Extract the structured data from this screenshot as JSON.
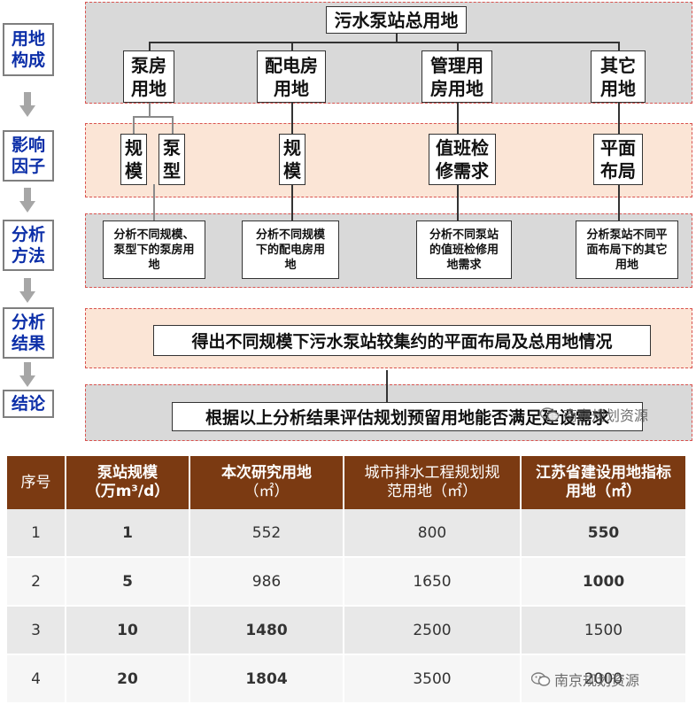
{
  "stages": [
    {
      "label": "用地构成"
    },
    {
      "label": "影响因子"
    },
    {
      "label": "分析方法"
    },
    {
      "label": "分析结果"
    },
    {
      "label": "结论"
    }
  ],
  "root": "污水泵站总用地",
  "components": [
    "泵房用地",
    "配电房用地",
    "管理用房用地",
    "其它用地"
  ],
  "factors": [
    "规模",
    "泵型",
    "规模",
    "值班检修需求",
    "平面布局"
  ],
  "methods": [
    "分析不同规模、泵型下的泵房用地",
    "分析不同规模下的配电房用地",
    "分析不同泵站的值班检修用地需求",
    "分析泵站不同平面布局下的其它用地"
  ],
  "result": "得出不同规模下污水泵站较集约的平面布局及总用地情况",
  "conclusion": "根据以上分析结果评估规划预留用地能否满足建设需求",
  "table": {
    "headers": [
      {
        "l1": "序号",
        "l2": ""
      },
      {
        "l1": "泵站规模",
        "l2": "（万m³/d）"
      },
      {
        "l1": "本次研究用地",
        "l2": "（㎡）"
      },
      {
        "l1": "城市排水工程规划规",
        "l2": "范用地（㎡）"
      },
      {
        "l1": "江苏省建设用地指标",
        "l2": "用地（㎡）"
      }
    ],
    "rows": [
      [
        "1",
        "1",
        "552",
        "800",
        "550"
      ],
      [
        "2",
        "5",
        "986",
        "1650",
        "1000"
      ],
      [
        "3",
        "10",
        "1480",
        "2500",
        "1500"
      ],
      [
        "4",
        "20",
        "1804",
        "3500",
        "2000"
      ]
    ]
  },
  "watermark": "南京规划资源",
  "colors": {
    "label_text": "#0b2ea8",
    "header_bg": "#7b3a12",
    "highlight": "#c00000"
  }
}
